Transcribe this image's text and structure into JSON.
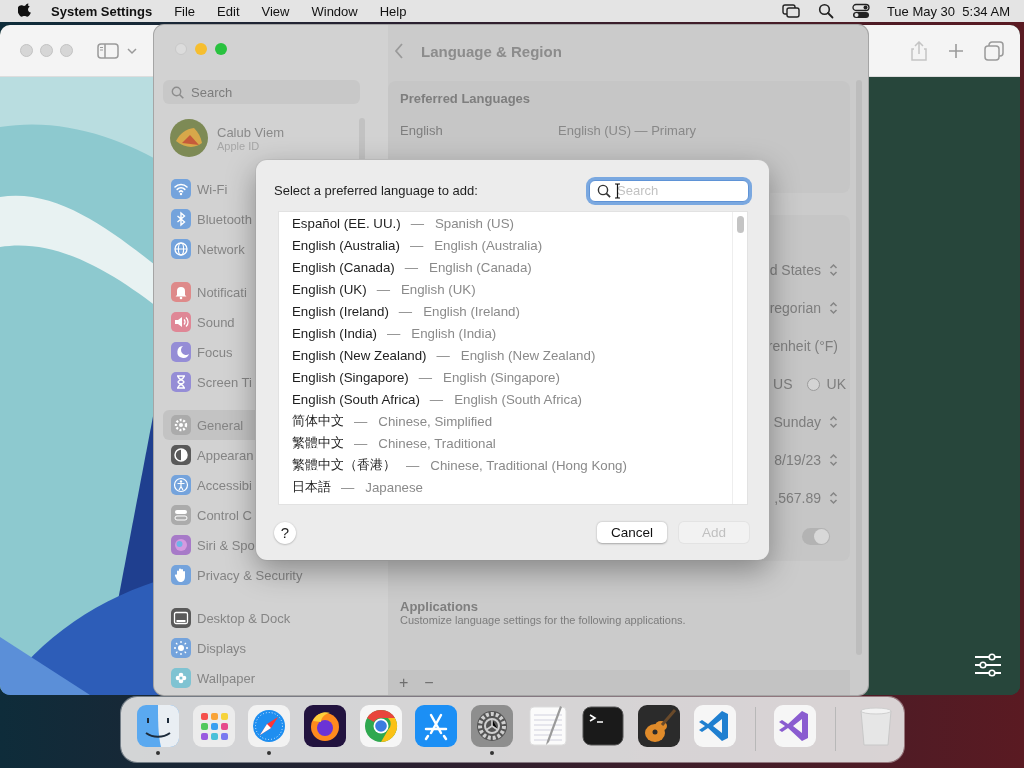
{
  "menu_bar": {
    "app_name": "System Settings",
    "menus": [
      "File",
      "Edit",
      "View",
      "Window",
      "Help"
    ],
    "clock": "Tue May 30  5:34 AM"
  },
  "settings_window": {
    "title": "Language & Region",
    "sidebar": {
      "search_placeholder": "Search",
      "account": {
        "name": "Calub Viem",
        "subtitle": "Apple ID"
      },
      "groups": [
        [
          {
            "kind": "wifi",
            "label": "Wi-Fi",
            "selected": false
          },
          {
            "kind": "bluetooth",
            "label": "Bluetooth",
            "selected": false
          },
          {
            "kind": "network",
            "label": "Network",
            "selected": false
          }
        ],
        [
          {
            "kind": "notifications",
            "label": "Notificati",
            "selected": false
          },
          {
            "kind": "sound",
            "label": "Sound",
            "selected": false
          },
          {
            "kind": "focus",
            "label": "Focus",
            "selected": false
          },
          {
            "kind": "screentime",
            "label": "Screen Ti",
            "selected": false
          }
        ],
        [
          {
            "kind": "general",
            "label": "General",
            "selected": true
          },
          {
            "kind": "appearance",
            "label": "Appearan",
            "selected": false
          },
          {
            "kind": "accessibility",
            "label": "Accessibi",
            "selected": false
          },
          {
            "kind": "controlcenter",
            "label": "Control C",
            "selected": false
          },
          {
            "kind": "siri",
            "label": "Siri & Spo",
            "selected": false
          },
          {
            "kind": "privacy",
            "label": "Privacy & Security",
            "selected": false
          }
        ],
        [
          {
            "kind": "desktop",
            "label": "Desktop & Dock",
            "selected": false
          },
          {
            "kind": "displays",
            "label": "Displays",
            "selected": false
          },
          {
            "kind": "wallpaper",
            "label": "Wallpaper",
            "selected": false
          }
        ]
      ]
    },
    "preferred": {
      "title": "Preferred Languages",
      "languages": [
        {
          "name": "English",
          "detail": "English (US) — Primary"
        }
      ]
    },
    "region_rows": [
      {
        "kind": "popup",
        "value": "d States"
      },
      {
        "kind": "popup",
        "value": "regorian"
      },
      {
        "kind": "text",
        "value": "renheit (°F)"
      },
      {
        "kind": "radio",
        "options": [
          {
            "label": "US"
          },
          {
            "label": "UK",
            "selected": false
          }
        ]
      },
      {
        "kind": "popup",
        "value": "Sunday"
      },
      {
        "kind": "popup",
        "value": "8/19/23"
      },
      {
        "kind": "popup",
        "value": ",567.89"
      },
      {
        "kind": "toggle",
        "on": true
      }
    ],
    "applications": {
      "title": "Applications",
      "description": "Customize language settings for the following applications.",
      "buttons": [
        "+",
        "−"
      ]
    }
  },
  "dialog": {
    "prompt": "Select a preferred language to add:",
    "search": {
      "placeholder": "Search",
      "focused": true
    },
    "languages": [
      {
        "native": "Español (EE. UU.)",
        "dash": "—",
        "english": "Spanish (US)",
        "selected": false
      },
      {
        "native": "English (Australia)",
        "dash": "—",
        "english": "English (Australia)",
        "selected": false
      },
      {
        "native": "English (Canada)",
        "dash": "—",
        "english": "English (Canada)",
        "selected": false
      },
      {
        "native": "English (UK)",
        "dash": "—",
        "english": "English (UK)",
        "selected": false
      },
      {
        "native": "English (Ireland)",
        "dash": "—",
        "english": "English (Ireland)",
        "selected": false
      },
      {
        "native": "English (India)",
        "dash": "—",
        "english": "English (India)",
        "selected": false
      },
      {
        "native": "English (New Zealand)",
        "dash": "—",
        "english": "English (New Zealand)",
        "selected": false
      },
      {
        "native": "English (Singapore)",
        "dash": "—",
        "english": "English (Singapore)",
        "selected": false
      },
      {
        "native": "English (South Africa)",
        "dash": "—",
        "english": "English (South Africa)",
        "selected": false
      },
      {
        "native": "简体中文",
        "dash": "—",
        "english": "Chinese, Simplified",
        "selected": false
      },
      {
        "native": "繁體中文",
        "dash": "—",
        "english": "Chinese, Traditional",
        "selected": false
      },
      {
        "native": "繁體中文（香港）",
        "dash": "—",
        "english": "Chinese, Traditional (Hong Kong)",
        "selected": false
      },
      {
        "native": "日本語",
        "dash": "—",
        "english": "Japanese",
        "selected": false
      }
    ],
    "help": "?",
    "buttons": [
      {
        "label": "Cancel",
        "disabled": false
      },
      {
        "label": "Add",
        "disabled": true
      }
    ]
  },
  "dock": {
    "sections": [
      [
        {
          "kind": "finder",
          "running": true
        },
        {
          "kind": "launchpad",
          "running": false
        },
        {
          "kind": "safari",
          "running": true
        },
        {
          "kind": "firefox",
          "running": false
        },
        {
          "kind": "chrome",
          "running": false
        },
        {
          "kind": "appstore",
          "running": false
        },
        {
          "kind": "settings",
          "running": true
        },
        {
          "kind": "textedit",
          "running": false
        },
        {
          "kind": "terminal",
          "running": false
        },
        {
          "kind": "garageband",
          "running": false
        },
        {
          "kind": "vscode",
          "running": false
        }
      ],
      [
        {
          "kind": "visualstudio",
          "running": false
        }
      ],
      [
        {
          "kind": "trash",
          "running": false
        }
      ]
    ]
  }
}
